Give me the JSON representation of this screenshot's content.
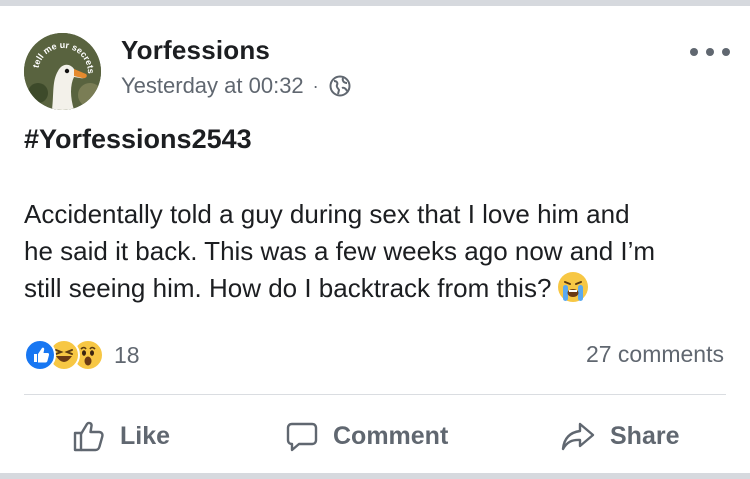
{
  "post": {
    "page_name": "Yorfessions",
    "avatar_caption": "tell me ur secrets",
    "timestamp": "Yesterday at 00:32",
    "separator": "·",
    "audience_icon": "globe-icon",
    "more_icon": "more-options-icon",
    "hashtag": "#Yorfessions2543",
    "body_lines": [
      "Accidentally told a guy during sex that I love him and",
      "he said it back. This was a few weeks ago now and I’m",
      "still seeing him. How do I backtrack from this?"
    ],
    "body_emoji": "crying-face-emoji"
  },
  "engagement": {
    "reaction_icons": [
      "like-reaction-icon",
      "haha-reaction-icon",
      "wow-reaction-icon"
    ],
    "reaction_count": "18",
    "comments": "27 comments"
  },
  "actions": {
    "like": "Like",
    "comment": "Comment",
    "share": "Share"
  },
  "colors": {
    "text": "#1c1e21",
    "secondary_text": "#606770",
    "like_blue": "#1877f2",
    "reaction_yellow": "#f7c744",
    "border_gray": "#d6d9de"
  }
}
